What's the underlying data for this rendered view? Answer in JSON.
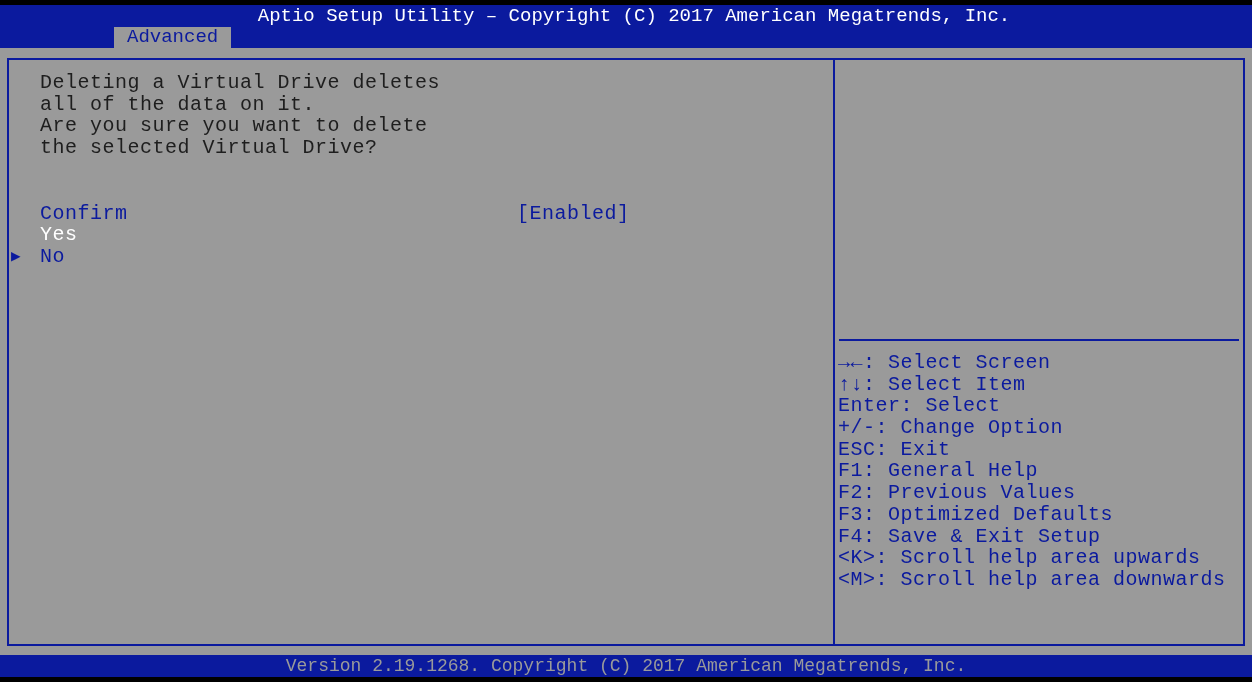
{
  "header": {
    "title": "Aptio Setup Utility – Copyright (C) 2017 American Megatrends, Inc."
  },
  "tabs": [
    {
      "label": "Advanced",
      "selected": true
    }
  ],
  "message": [
    "Deleting a Virtual Drive deletes",
    "all of the data on it.",
    "Are you sure you want to delete",
    "the selected Virtual Drive?"
  ],
  "items": [
    {
      "label": "Confirm",
      "value": "[Enabled]",
      "selected": false
    },
    {
      "label": "Yes",
      "selected": true
    },
    {
      "label": "No",
      "selected": false,
      "marker": "▶"
    }
  ],
  "help_keys": [
    "→←: Select Screen",
    "↑↓: Select Item",
    "Enter: Select",
    "+/-: Change Option",
    "ESC: Exit",
    "F1: General Help",
    "F2: Previous Values",
    "F3: Optimized Defaults",
    "F4: Save & Exit Setup",
    "<K>: Scroll help area upwards",
    "<M>: Scroll help area downwards"
  ],
  "footer": {
    "text": "Version 2.19.1268. Copyright (C) 2017 American Megatrends, Inc."
  }
}
